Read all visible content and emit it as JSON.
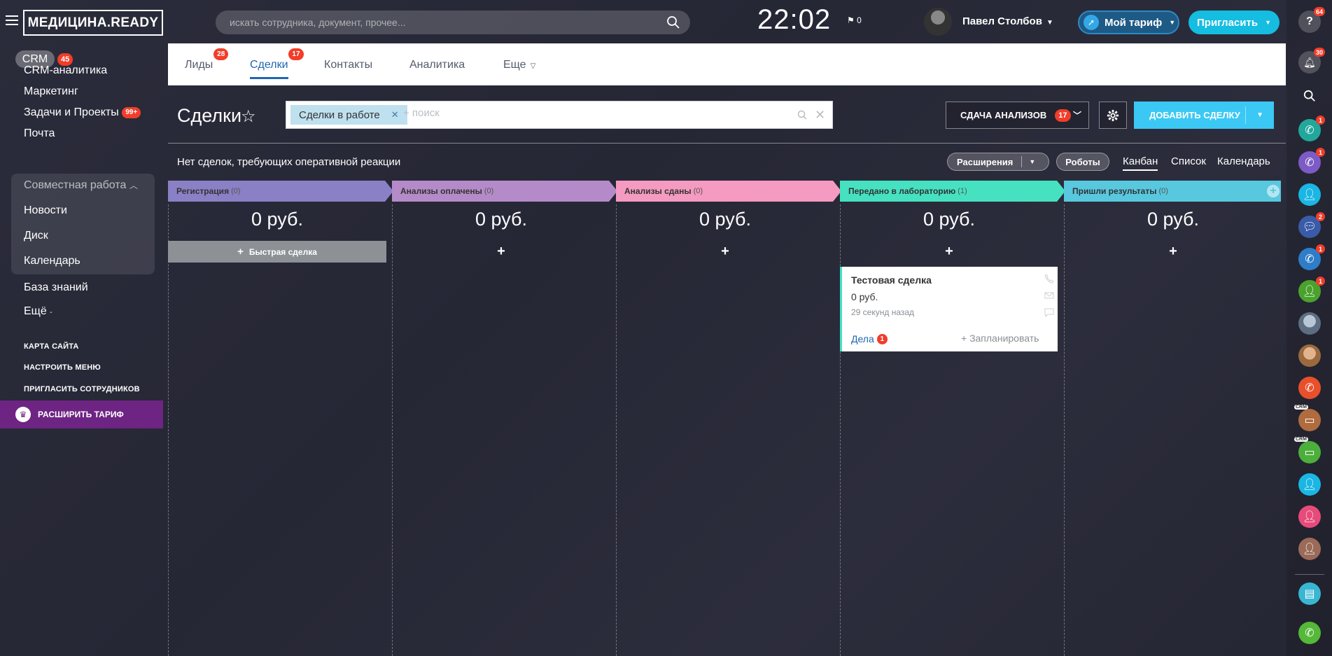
{
  "header": {
    "logo": "МЕДИЦИНА.READY",
    "search_placeholder": "искать сотрудника, документ, прочее...",
    "clock": "22:02",
    "flag_count": "0",
    "user_name": "Павел Столбов",
    "tariff_label": "Мой тариф",
    "invite_label": "Пригласить"
  },
  "left_menu": {
    "crm_label": "CRM",
    "crm_badge": "45",
    "items": [
      {
        "label": "CRM-аналитика"
      },
      {
        "label": "Маркетинг"
      },
      {
        "label": "Задачи и Проекты",
        "badge": "99+"
      },
      {
        "label": "Почта"
      }
    ],
    "group_label": "Совместная работа",
    "group_items": [
      {
        "label": "Новости"
      },
      {
        "label": "Диск"
      },
      {
        "label": "Календарь"
      }
    ],
    "knowledge": "База знаний",
    "more": "Ещё",
    "small_links": [
      "КАРТА САЙТА",
      "НАСТРОИТЬ МЕНЮ",
      "ПРИГЛАСИТЬ СОТРУДНИКОВ"
    ],
    "upgrade_label": "РАСШИРИТЬ ТАРИФ"
  },
  "tabs": [
    {
      "label": "Лиды",
      "badge": "28"
    },
    {
      "label": "Сделки",
      "badge": "17"
    },
    {
      "label": "Контакты"
    },
    {
      "label": "Аналитика"
    },
    {
      "label": "Еще"
    }
  ],
  "toolbar": {
    "title": "Сделки",
    "filter_tag": "Сделки в работе",
    "filter_placeholder": "+ поиск",
    "analyses_label": "СДАЧА АНАЛИЗОВ",
    "analyses_badge": "17",
    "add_deal_label": "ДОБАВИТЬ СДЕЛКУ"
  },
  "subbar": {
    "notice": "Нет сделок, требующих оперативной реакции",
    "extensions_label": "Расширения",
    "robots_label": "Роботы",
    "views": [
      "Канбан",
      "Список",
      "Календарь"
    ]
  },
  "kanban": {
    "quick_deal_label": "Быстрая сделка",
    "stages": [
      {
        "name": "Регистрация",
        "count": "(0)",
        "sum": "0 руб.",
        "color": "#8a80c5"
      },
      {
        "name": "Анализы оплачены",
        "count": "(0)",
        "sum": "0 руб.",
        "color": "#b48bc8"
      },
      {
        "name": "Анализы сданы",
        "count": "(0)",
        "sum": "0 руб.",
        "color": "#f59ac0"
      },
      {
        "name": "Передано в лабораторию",
        "count": "(1)",
        "sum": "0 руб.",
        "color": "#46e1c1"
      },
      {
        "name": "Пришли результаты",
        "count": "(0)",
        "sum": "0 руб.",
        "color": "#58c8df"
      }
    ],
    "card": {
      "title": "Тестовая сделка",
      "sum": "0 руб.",
      "time": "29 секунд назад",
      "tasks_label": "Дела",
      "tasks_badge": "1",
      "plan_label": "+ Запланировать"
    }
  },
  "right_bar": {
    "help_badge": "64",
    "bell_badge": "30",
    "badges": [
      "1",
      "1",
      "",
      "2",
      "1",
      "1"
    ]
  }
}
